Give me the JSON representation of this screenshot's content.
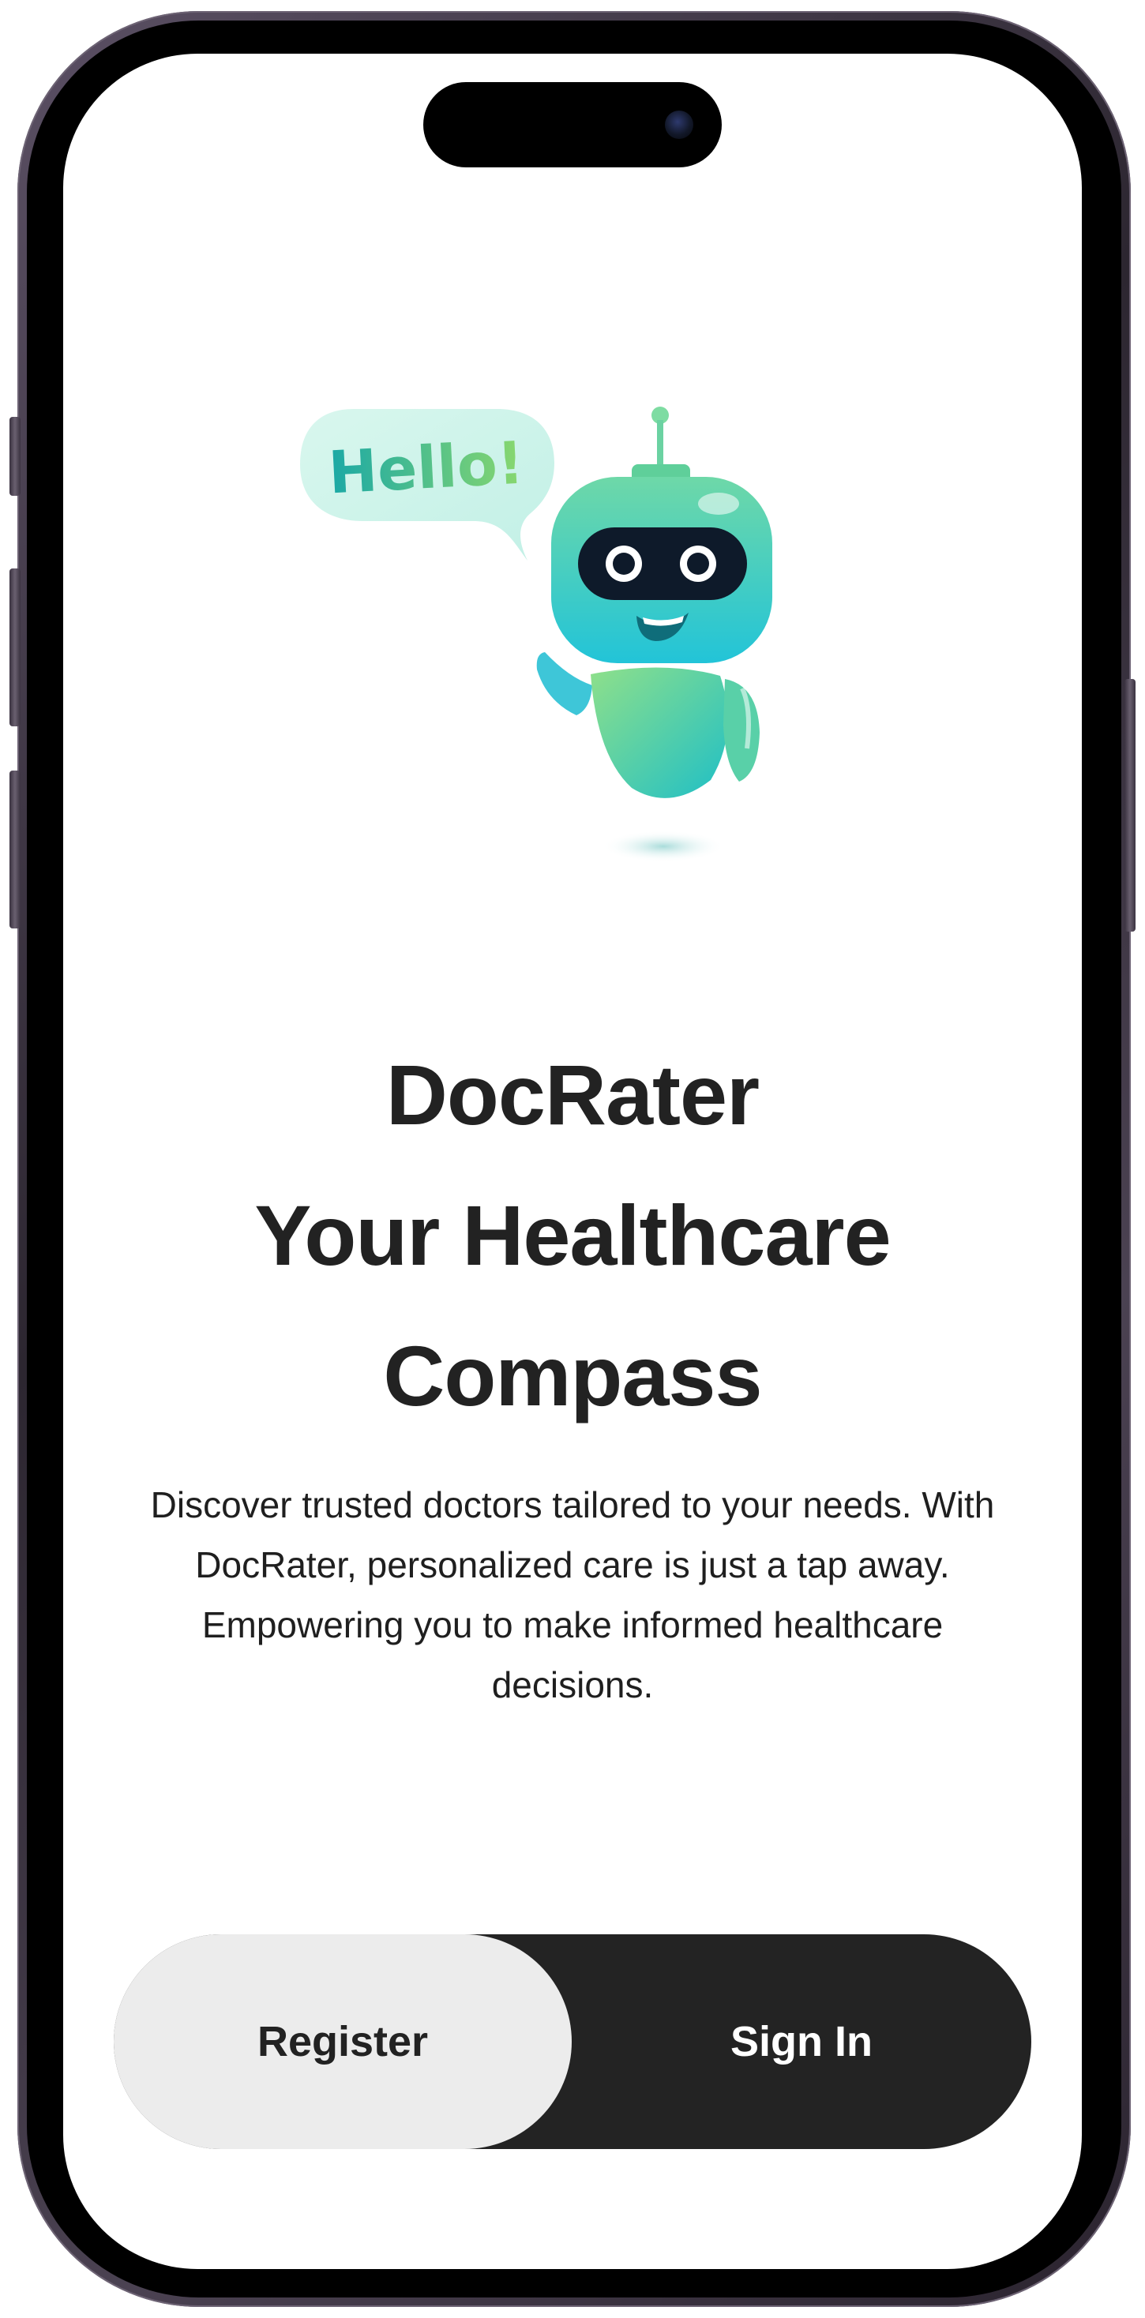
{
  "illustration": {
    "bubble_text": "Hello!",
    "icon": "robot-mascot-icon"
  },
  "hero": {
    "title_line_1": "DocRater",
    "title_line_2": "Your Healthcare",
    "title_line_3": "Compass",
    "description": "Discover trusted doctors tailored to your needs. With DocRater, personalized care is just a tap away. Empowering you to make informed healthcare decisions."
  },
  "auth": {
    "register_label": "Register",
    "signin_label": "Sign In"
  },
  "colors": {
    "primary_dark": "#232323",
    "secondary_light": "#ececec",
    "text": "#222222",
    "mascot_teal": "#2ec8c2",
    "mascot_green": "#8fe08a"
  }
}
